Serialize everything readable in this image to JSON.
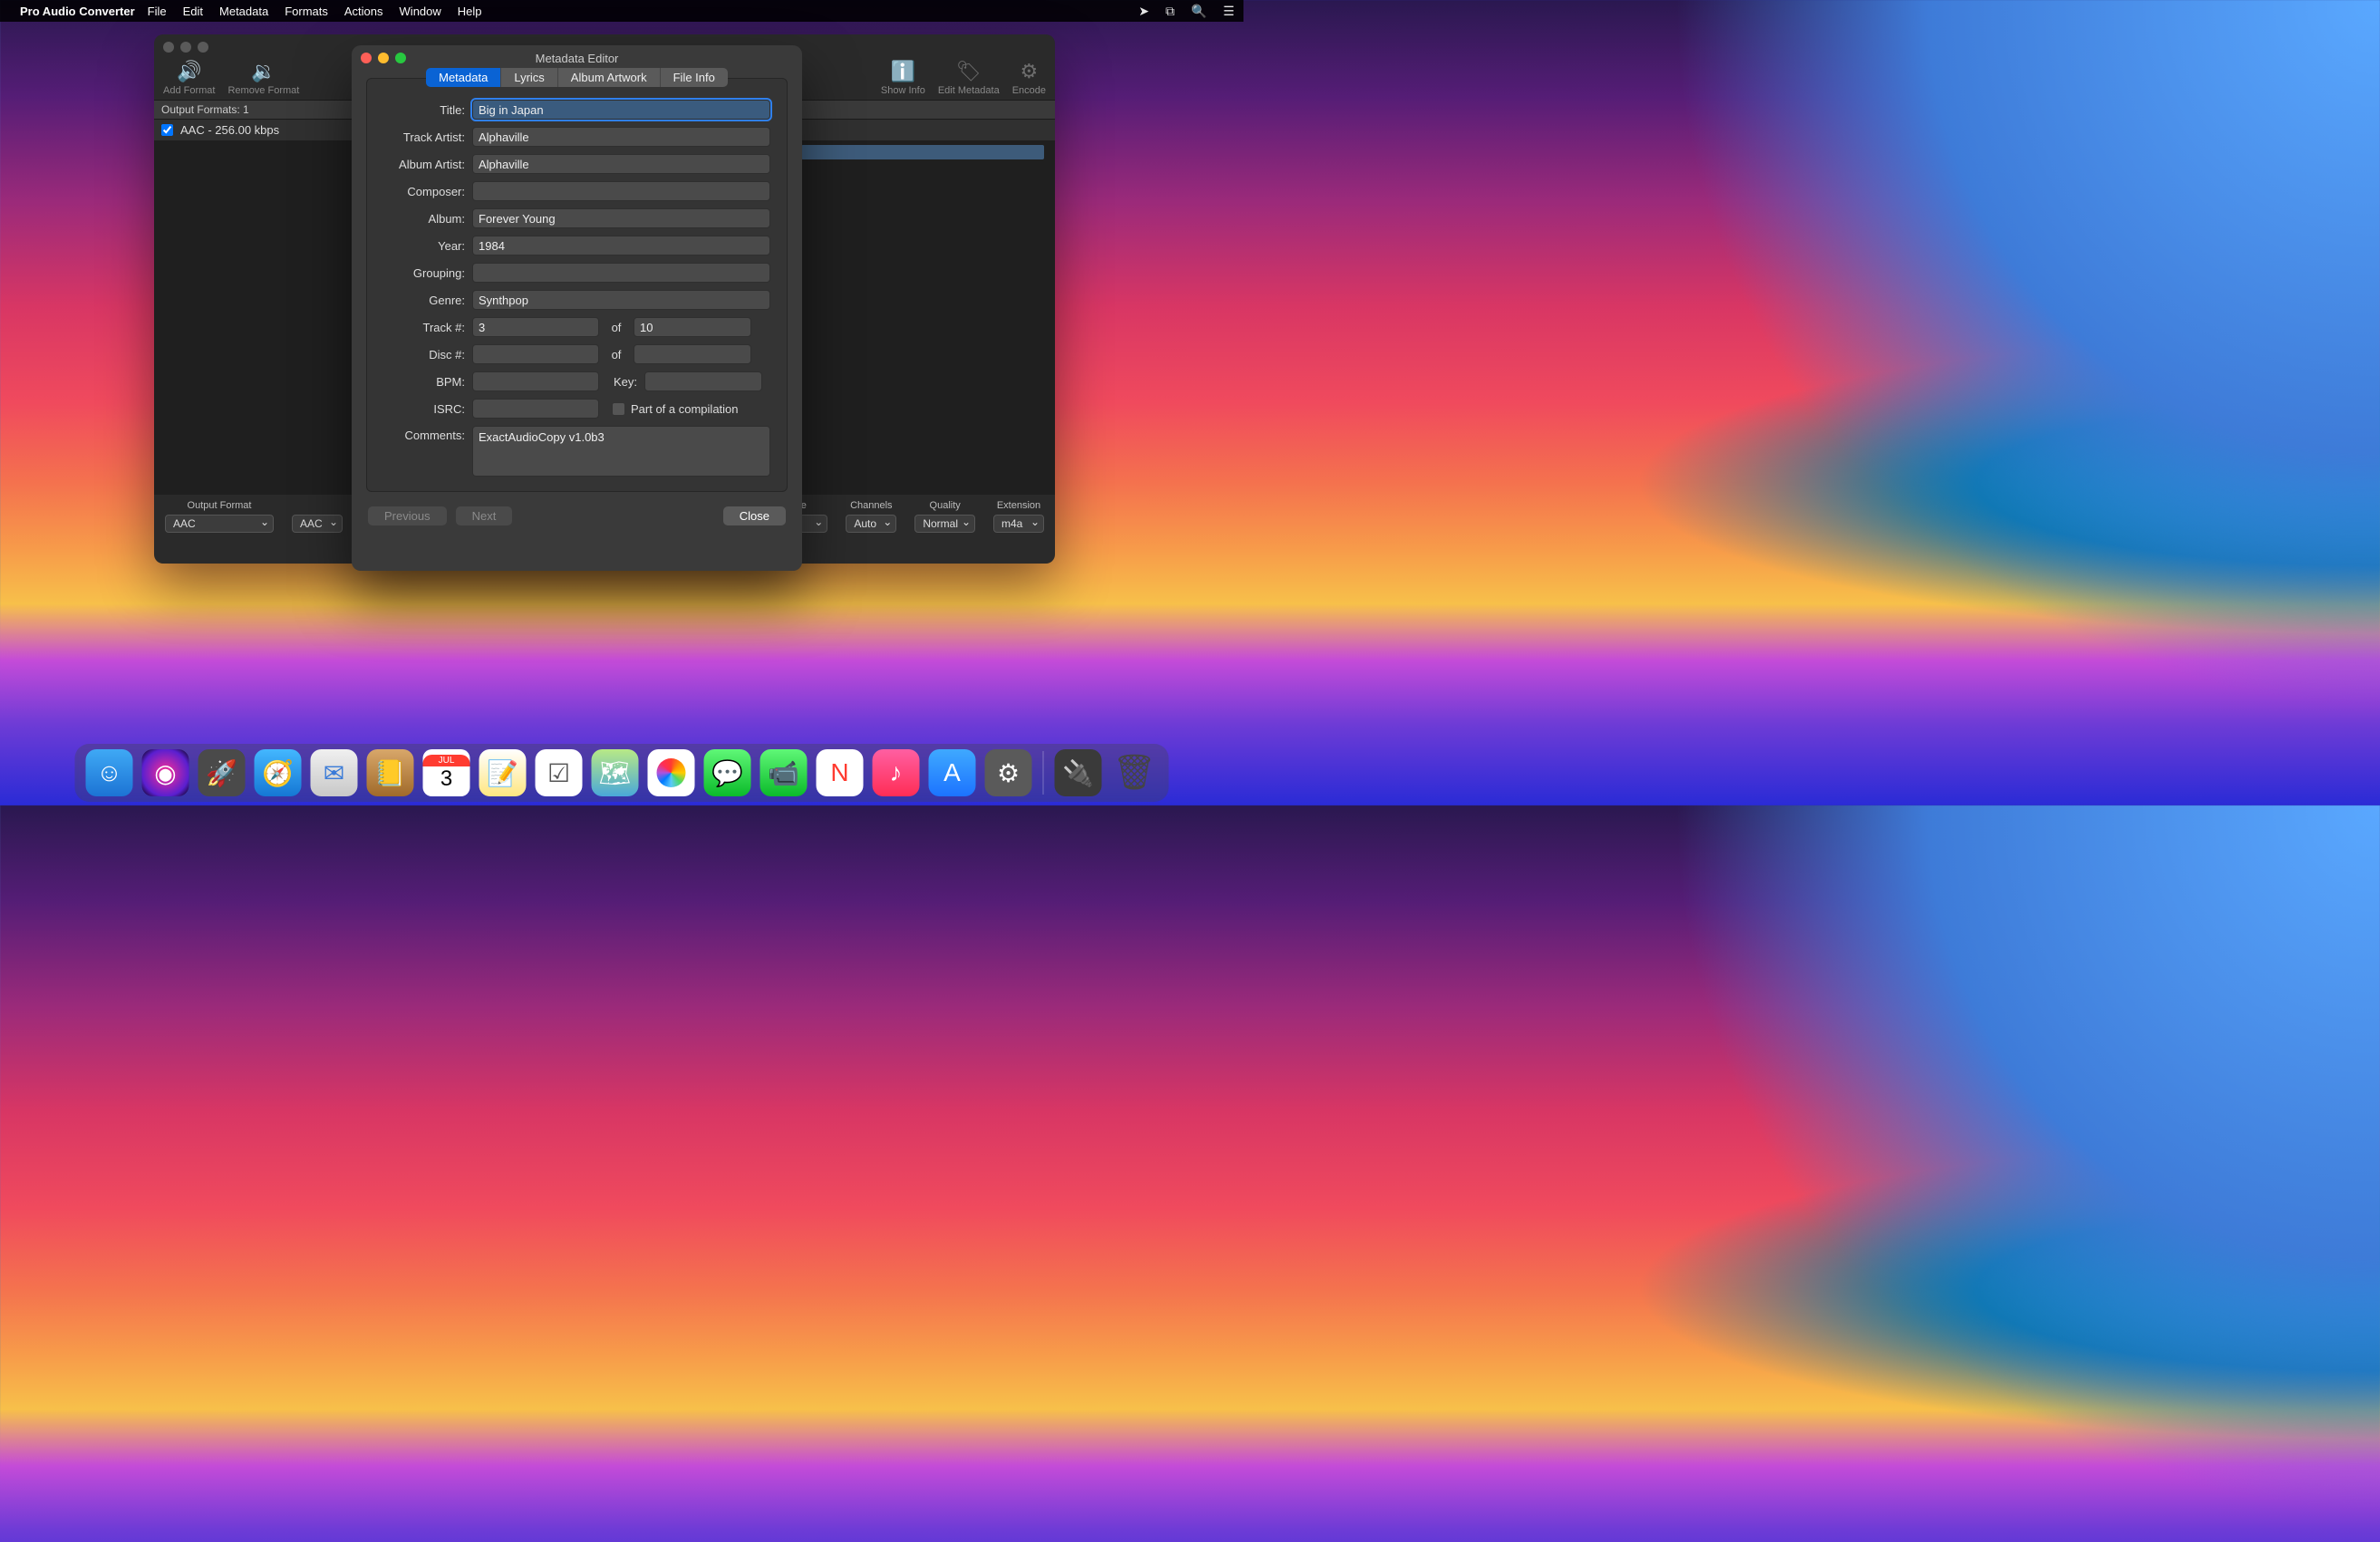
{
  "menubar": {
    "app_name": "Pro Audio Converter",
    "items": [
      "File",
      "Edit",
      "Metadata",
      "Formats",
      "Actions",
      "Window",
      "Help"
    ]
  },
  "main_window": {
    "toolbar": {
      "add_format": "Add Format",
      "remove_format": "Remove Format",
      "show_info": "Show Info",
      "edit_metadata": "Edit Metadata",
      "encode": "Encode"
    },
    "output_formats_label": "Output Formats: 1",
    "format_row": "AAC - 256.00 kbps",
    "bottom": {
      "output_format": {
        "label": "Output Format",
        "value": "AAC"
      },
      "aac_label": "AAC",
      "rate": {
        "label": "te",
        "value": ""
      },
      "channels": {
        "label": "Channels",
        "value": "Auto"
      },
      "quality": {
        "label": "Quality",
        "value": "Normal"
      },
      "extension": {
        "label": "Extension",
        "value": "m4a"
      }
    }
  },
  "modal": {
    "title": "Metadata Editor",
    "tabs": [
      "Metadata",
      "Lyrics",
      "Album Artwork",
      "File Info"
    ],
    "active_tab": 0,
    "fields": {
      "title": {
        "label": "Title:",
        "value": "Big in Japan"
      },
      "track_artist": {
        "label": "Track Artist:",
        "value": "Alphaville"
      },
      "album_artist": {
        "label": "Album Artist:",
        "value": "Alphaville"
      },
      "composer": {
        "label": "Composer:",
        "value": ""
      },
      "album": {
        "label": "Album:",
        "value": "Forever Young"
      },
      "year": {
        "label": "Year:",
        "value": "1984"
      },
      "grouping": {
        "label": "Grouping:",
        "value": ""
      },
      "genre": {
        "label": "Genre:",
        "value": "Synthpop"
      },
      "track_no": {
        "label": "Track #:",
        "value": "3",
        "of_label": "of",
        "total": "10"
      },
      "disc_no": {
        "label": "Disc #:",
        "value": "",
        "of_label": "of",
        "total": ""
      },
      "bpm": {
        "label": "BPM:",
        "value": ""
      },
      "key": {
        "label": "Key:",
        "value": ""
      },
      "isrc": {
        "label": "ISRC:",
        "value": ""
      },
      "compilation": {
        "label": "Part of a compilation"
      },
      "comments": {
        "label": "Comments:",
        "value": "ExactAudioCopy v1.0b3"
      }
    },
    "buttons": {
      "previous": "Previous",
      "next": "Next",
      "close": "Close"
    }
  },
  "dock": {
    "calendar": {
      "month": "JUL",
      "day": "3"
    }
  }
}
